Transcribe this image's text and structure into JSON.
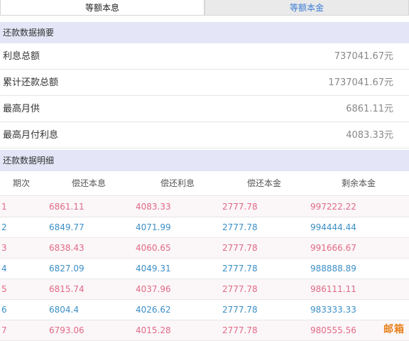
{
  "tabs": [
    {
      "label": "等额本息",
      "active": false
    },
    {
      "label": "等额本金",
      "active": true
    }
  ],
  "summary": {
    "header": "还款数据摘要",
    "rows": [
      {
        "label": "利息总额",
        "value": "737041.67元"
      },
      {
        "label": "累计还款总额",
        "value": "1737041.67元"
      },
      {
        "label": "最高月供",
        "value": "6861.11元"
      },
      {
        "label": "最高月付利息",
        "value": "4083.33元"
      }
    ]
  },
  "detail": {
    "header": "还款数据明细",
    "columns": [
      "期次",
      "偿还本息",
      "偿还利息",
      "偿还本金",
      "剩余本金"
    ],
    "rows": [
      [
        "1",
        "6861.11",
        "4083.33",
        "2777.78",
        "997222.22"
      ],
      [
        "2",
        "6849.77",
        "4071.99",
        "2777.78",
        "994444.44"
      ],
      [
        "3",
        "6838.43",
        "4060.65",
        "2777.78",
        "991666.67"
      ],
      [
        "4",
        "6827.09",
        "4049.31",
        "2777.78",
        "988888.89"
      ],
      [
        "5",
        "6815.74",
        "4037.96",
        "2777.78",
        "986111.11"
      ],
      [
        "6",
        "6804.4",
        "4026.62",
        "2777.78",
        "983333.33"
      ],
      [
        "7",
        "6793.06",
        "4015.28",
        "2777.78",
        "980555.56"
      ]
    ]
  },
  "watermark": "邮箱",
  "colors": {
    "odd_row_text": "#e06a86",
    "even_row_text": "#3b8fc7",
    "section_header_bg": "#e4e6f7",
    "active_tab_text": "#3a7bd5"
  }
}
